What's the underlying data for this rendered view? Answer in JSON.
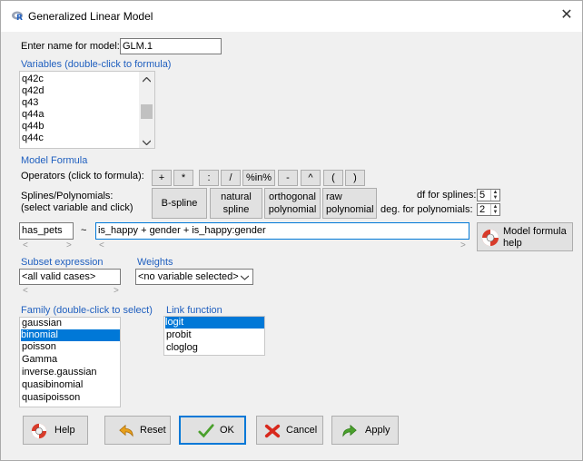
{
  "window": {
    "title": "Generalized Linear Model",
    "close_glyph": "✕"
  },
  "model_name": {
    "label": "Enter name for model:",
    "value": "GLM.1"
  },
  "variables": {
    "label": "Variables (double-click to formula)",
    "items": [
      "q42c",
      "q42d",
      "q43",
      "q44a",
      "q44b",
      "q44c"
    ]
  },
  "model_formula": {
    "label": "Model Formula",
    "operators_label": "Operators (click to formula):",
    "operators": [
      "+",
      "*",
      ":",
      "/",
      "%in%",
      "-",
      "^",
      "(",
      ")"
    ],
    "splines_label_1": "Splines/Polynomials:",
    "splines_label_2": "(select variable and click)",
    "bspline": "B-spline",
    "natural_1": "natural",
    "natural_2": "spline",
    "orthogonal_1": "orthogonal",
    "orthogonal_2": "polynomial",
    "raw_1": "raw",
    "raw_2": "polynomial",
    "df_splines_label": "df for splines:",
    "df_splines_value": "5",
    "deg_poly_label": "deg. for polynomials:",
    "deg_poly_value": "2",
    "lhs": "has_pets",
    "tilde": "~",
    "rhs": "is_happy + gender + is_happy:gender",
    "help_1": "Model formula",
    "help_2": "help"
  },
  "subset": {
    "label": "Subset expression",
    "value": "<all valid cases>"
  },
  "weights": {
    "label": "Weights",
    "value": "<no variable selected>"
  },
  "family": {
    "label": "Family (double-click to select)",
    "items": [
      "gaussian",
      "binomial",
      "poisson",
      "Gamma",
      "inverse.gaussian",
      "quasibinomial",
      "quasipoisson"
    ],
    "selected": "binomial"
  },
  "link": {
    "label": "Link function",
    "items": [
      "logit",
      "probit",
      "cloglog"
    ],
    "selected": "logit"
  },
  "buttons": {
    "help": "Help",
    "reset": "Reset",
    "ok": "OK",
    "cancel": "Cancel",
    "apply": "Apply"
  },
  "colors": {
    "accent_blue": "#1f5fbf",
    "selection": "#0078d7"
  }
}
